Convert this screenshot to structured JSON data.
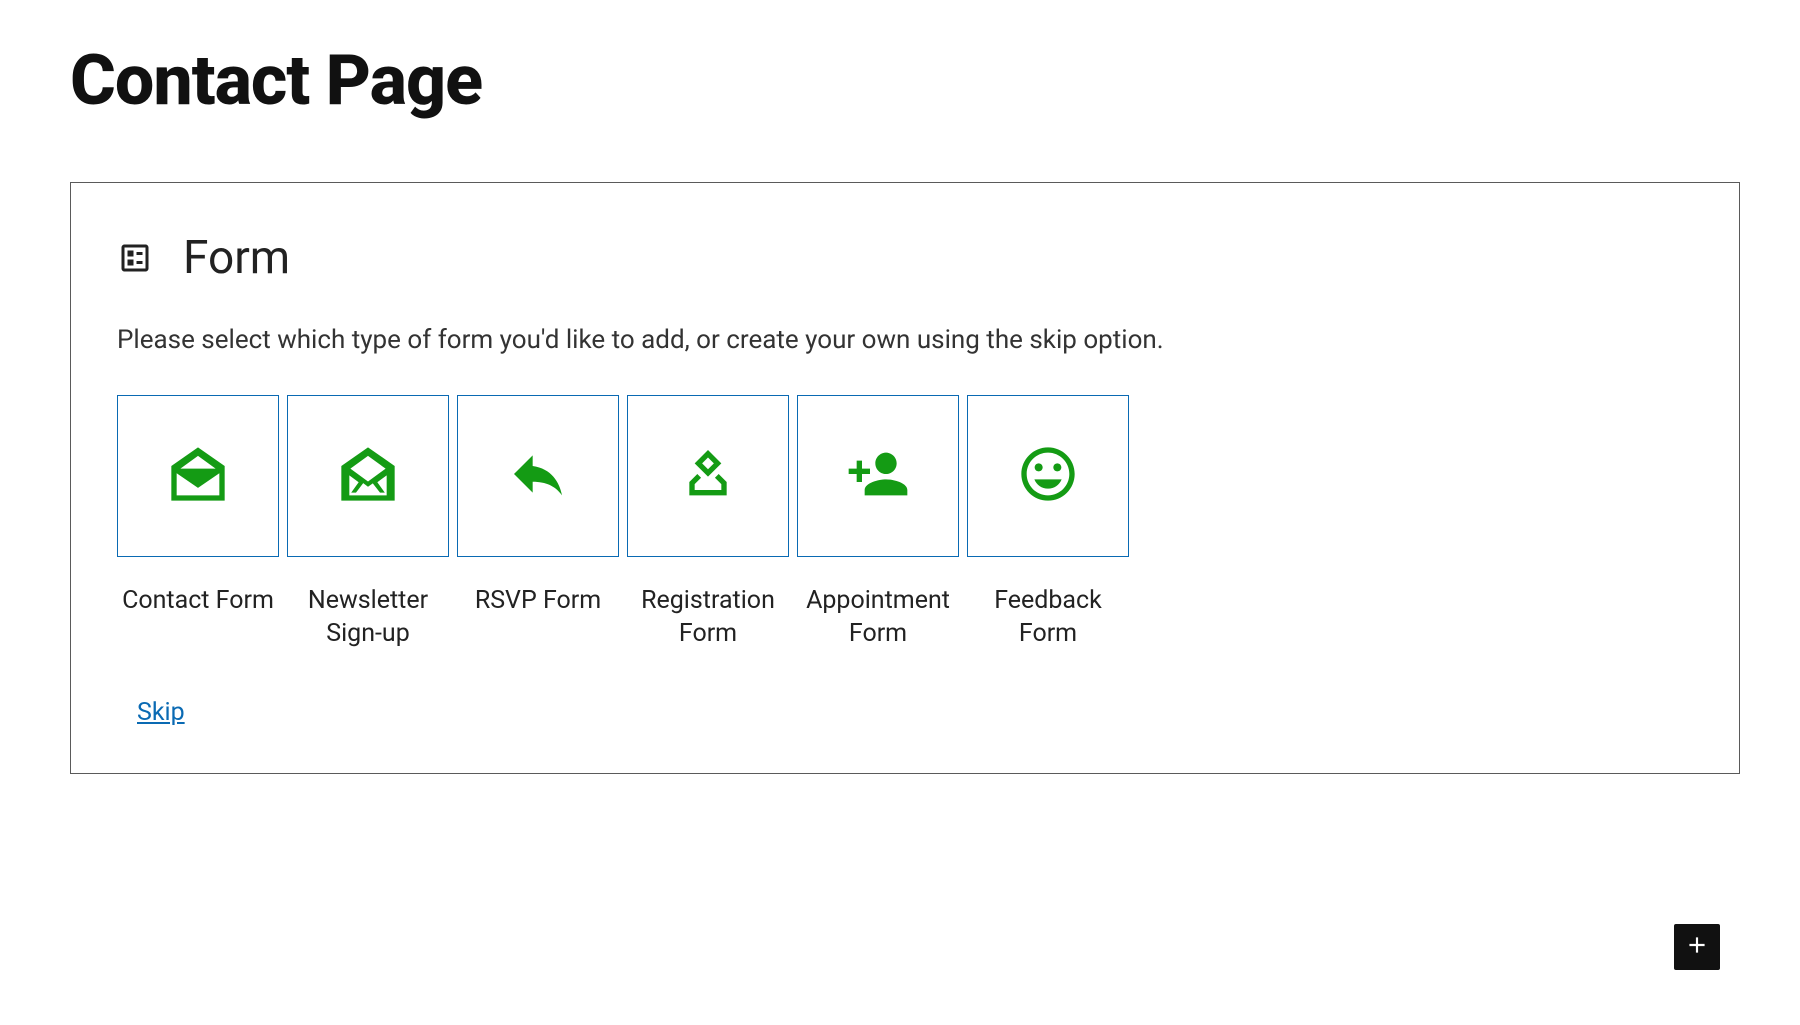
{
  "page": {
    "title": "Contact Page"
  },
  "block": {
    "icon": "form-icon",
    "title": "Form",
    "description": "Please select which type of form you'd like to add, or create your own using the skip option.",
    "options": [
      {
        "icon": "envelope-open-icon",
        "label": "Contact Form"
      },
      {
        "icon": "newsletter-icon",
        "label": "Newsletter Sign-up"
      },
      {
        "icon": "reply-icon",
        "label": "RSVP Form"
      },
      {
        "icon": "ballot-icon",
        "label": "Registration Form"
      },
      {
        "icon": "person-add-icon",
        "label": "Appointment Form"
      },
      {
        "icon": "smile-icon",
        "label": "Feedback Form"
      }
    ],
    "skip_label": "Skip"
  },
  "fab": {
    "icon": "plus-icon"
  }
}
